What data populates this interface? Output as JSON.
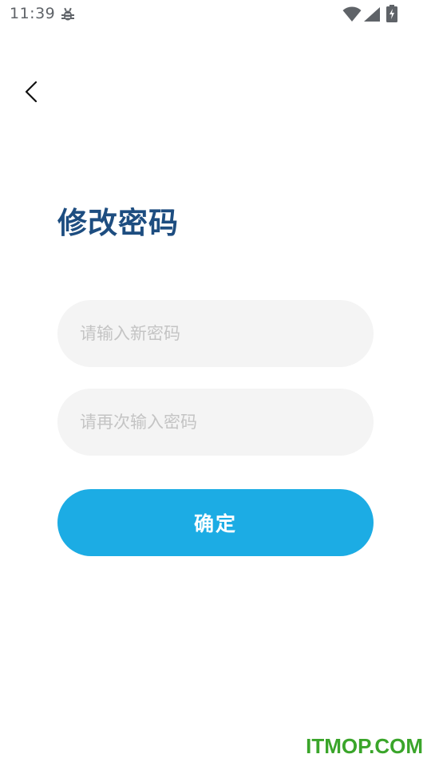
{
  "status_bar": {
    "time": "11:39"
  },
  "navigation": {
    "back_icon": "chevron-left-icon"
  },
  "page": {
    "title": "修改密码"
  },
  "form": {
    "new_password_placeholder": "请输入新密码",
    "confirm_password_placeholder": "请再次输入密码",
    "submit_label": "确定"
  },
  "watermark": {
    "text": "ITMOP.COM"
  },
  "colors": {
    "title": "#1d4d80",
    "button": "#1cace4",
    "input_bg": "#f4f4f4",
    "watermark": "#3aa52a"
  }
}
